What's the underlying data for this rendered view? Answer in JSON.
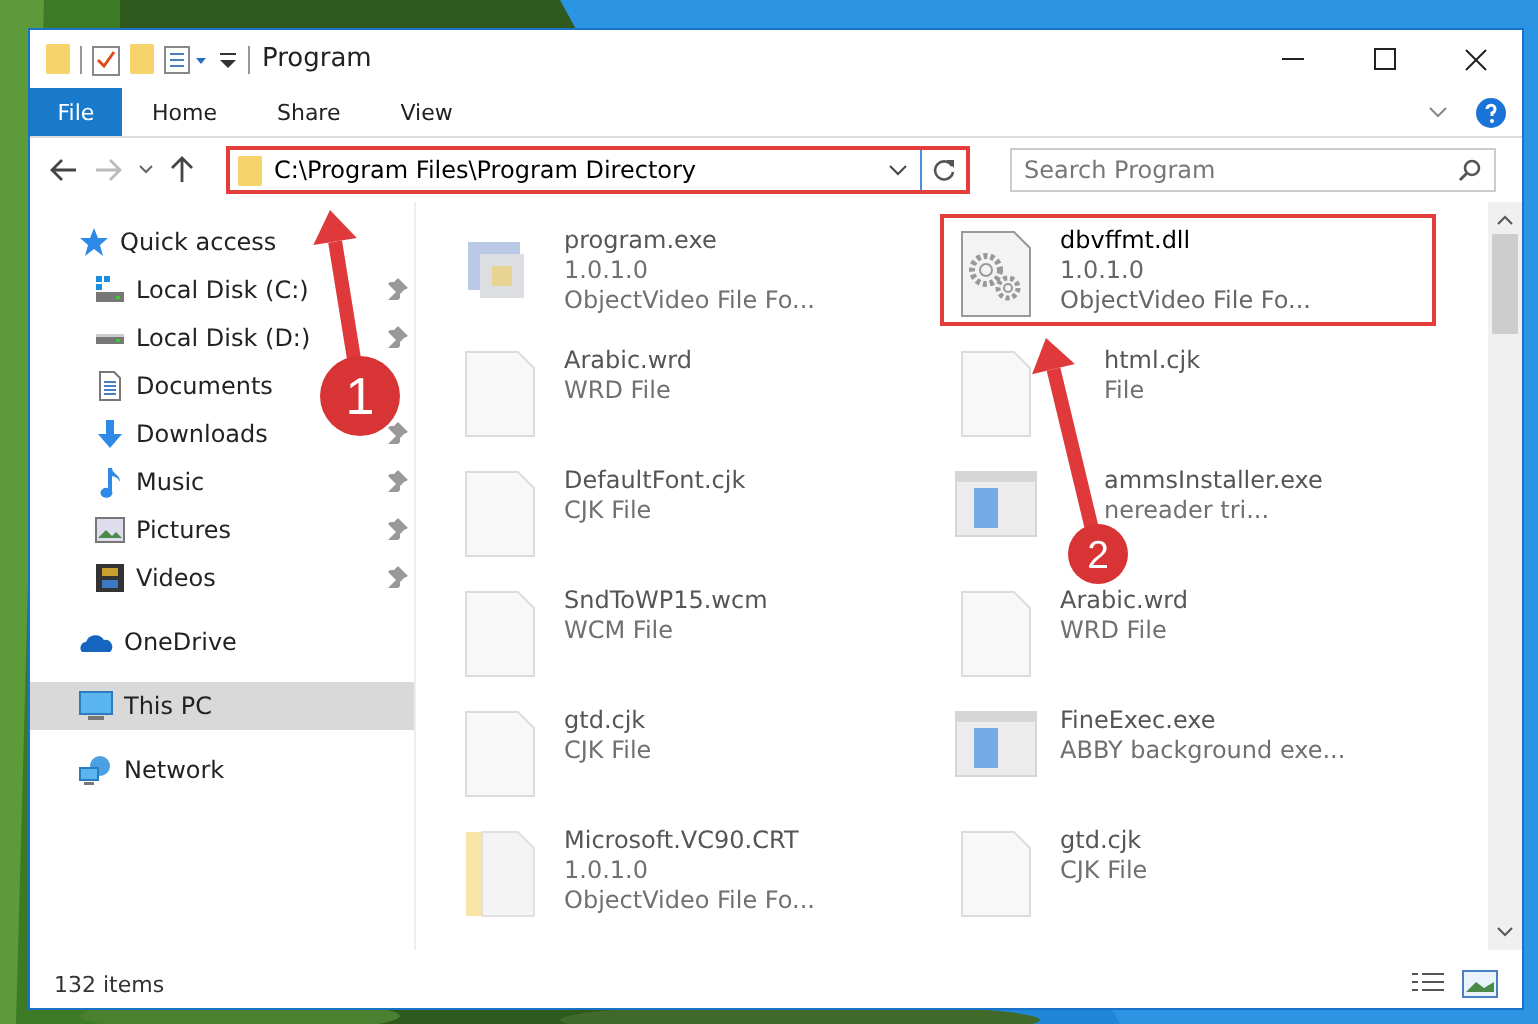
{
  "window": {
    "title": "Program"
  },
  "ribbon": {
    "tabs": [
      {
        "label": "File",
        "kind": "file",
        "selected": false
      },
      {
        "label": "Home",
        "kind": "tab",
        "selected": false
      },
      {
        "label": "Share",
        "kind": "tab",
        "selected": false
      },
      {
        "label": "View",
        "kind": "tab",
        "selected": false
      }
    ]
  },
  "address": {
    "path": "C:\\Program Files\\Program Directory",
    "highlighted": true
  },
  "search": {
    "placeholder": "Search Program"
  },
  "sidebar": {
    "items": [
      {
        "label": "Quick access",
        "kind": "star",
        "selected": false,
        "children": [
          {
            "label": "Local Disk (C:)",
            "kind": "disk-c",
            "pinned": true,
            "selected": false
          },
          {
            "label": "Local Disk (D:)",
            "kind": "disk",
            "pinned": true,
            "selected": false
          },
          {
            "label": "Documents",
            "kind": "documents",
            "pinned": false,
            "selected": false
          },
          {
            "label": "Downloads",
            "kind": "downloads",
            "pinned": true,
            "selected": false
          },
          {
            "label": "Music",
            "kind": "music",
            "pinned": true,
            "selected": false
          },
          {
            "label": "Pictures",
            "kind": "pictures",
            "pinned": true,
            "selected": false
          },
          {
            "label": "Videos",
            "kind": "videos",
            "pinned": true,
            "selected": false
          }
        ]
      },
      {
        "label": "OneDrive",
        "kind": "cloud",
        "selected": false
      },
      {
        "label": "This PC",
        "kind": "pc",
        "selected": true
      },
      {
        "label": "Network",
        "kind": "network",
        "selected": false
      }
    ]
  },
  "files": [
    {
      "name": "program.exe",
      "details": [
        "1.0.1.0",
        "ObjectVideo File Fo..."
      ],
      "kind": "app",
      "blurred": true,
      "highlighted": false
    },
    {
      "name": "dbvffmt.dll",
      "details": [
        "1.0.1.0",
        "ObjectVideo File Fo..."
      ],
      "kind": "dll",
      "blurred": false,
      "highlighted": true
    },
    {
      "name": "Arabic.wrd",
      "details": [
        "WRD File"
      ],
      "kind": "blank",
      "blurred": true,
      "highlighted": false
    },
    {
      "name": "html.cjk",
      "details": [
        "File"
      ],
      "kind": "blank",
      "blurred": true,
      "highlighted": false,
      "behind_arrow": true
    },
    {
      "name": "DefaultFont.cjk",
      "details": [
        "CJK File"
      ],
      "kind": "blank",
      "blurred": true,
      "highlighted": false
    },
    {
      "name": "ammsInstaller.exe",
      "details": [
        "nereader tri..."
      ],
      "kind": "window",
      "blurred": true,
      "highlighted": false,
      "behind_arrow": true
    },
    {
      "name": "SndToWP15.wcm",
      "details": [
        "WCM File"
      ],
      "kind": "blank",
      "blurred": true,
      "highlighted": false
    },
    {
      "name": "Arabic.wrd",
      "details": [
        "WRD File"
      ],
      "kind": "blank",
      "blurred": true,
      "highlighted": false
    },
    {
      "name": "gtd.cjk",
      "details": [
        "CJK File"
      ],
      "kind": "blank",
      "blurred": true,
      "highlighted": false
    },
    {
      "name": "FineExec.exe",
      "details": [
        "ABBY background exe..."
      ],
      "kind": "window",
      "blurred": true,
      "highlighted": false
    },
    {
      "name": "Microsoft.VC90.CRT",
      "details": [
        "1.0.1.0",
        "ObjectVideo File Fo..."
      ],
      "kind": "folder",
      "blurred": true,
      "highlighted": false
    },
    {
      "name": "gtd.cjk",
      "details": [
        "CJK File"
      ],
      "kind": "blank",
      "blurred": true,
      "highlighted": false
    }
  ],
  "status_bar": {
    "count": "132 items"
  },
  "annotations": [
    {
      "label": "1"
    },
    {
      "label": "2"
    }
  ]
}
